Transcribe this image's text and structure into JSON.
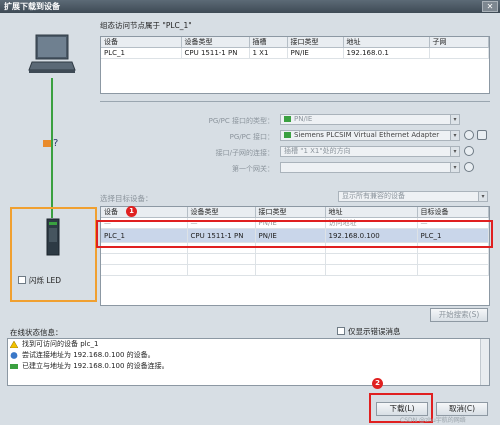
{
  "window": {
    "title": "扩展下载到设备",
    "close_glyph": "✕"
  },
  "configured": {
    "heading": "组态访问节点属于 \"PLC_1\"",
    "columns": [
      "设备",
      "设备类型",
      "插槽",
      "接口类型",
      "地址",
      "子网"
    ],
    "rows": [
      [
        "PLC_1",
        "CPU 1511-1 PN",
        "1 X1",
        "PN/IE",
        "192.168.0.1",
        ""
      ]
    ]
  },
  "interface": {
    "pgpc_type_label": "PG/PC 接口的类型：",
    "pgpc_type_value": "PN/IE",
    "pgpc_label": "PG/PC 接口：",
    "pgpc_value": "Siemens PLCSIM Virtual Ethernet Adapter",
    "subnet_conn_label": "接口/子网的连接：",
    "subnet_conn_value": "插槽 \"1 X1\"处的方向",
    "gateway_label": "第一个网关：",
    "gateway_value": ""
  },
  "target": {
    "select_label": "选择目标设备：",
    "filter_value": "显示所有兼容的设备",
    "columns": [
      "设备",
      "设备类型",
      "接口类型",
      "地址",
      "目标设备"
    ],
    "rows": [
      [
        "—",
        "—",
        "PN/IE",
        "访问地址",
        "—"
      ],
      [
        "PLC_1",
        "CPU 1511-1 PN",
        "PN/IE",
        "192.168.0.100",
        "PLC_1"
      ]
    ],
    "flash_led_label": "闪烁 LED",
    "start_search_label": "开始搜索(S)"
  },
  "status": {
    "label": "在线状态信息：",
    "errors_only_label": "仅显示错误消息",
    "messages": [
      {
        "icon": "warning-icon",
        "text": "找到可访问的设备 plc_1"
      },
      {
        "icon": "info-icon",
        "text": "尝试连接地址为 192.168.0.100 的设备。"
      },
      {
        "icon": "connected-icon",
        "text": "已建立与地址为 192.168.0.100 的设备连接。"
      }
    ]
  },
  "buttons": {
    "download": "下载(L)",
    "cancel": "取消(C)"
  },
  "badges": {
    "one": "1",
    "two": "2"
  },
  "watermark": "CSDN @zhu宇航的网络"
}
